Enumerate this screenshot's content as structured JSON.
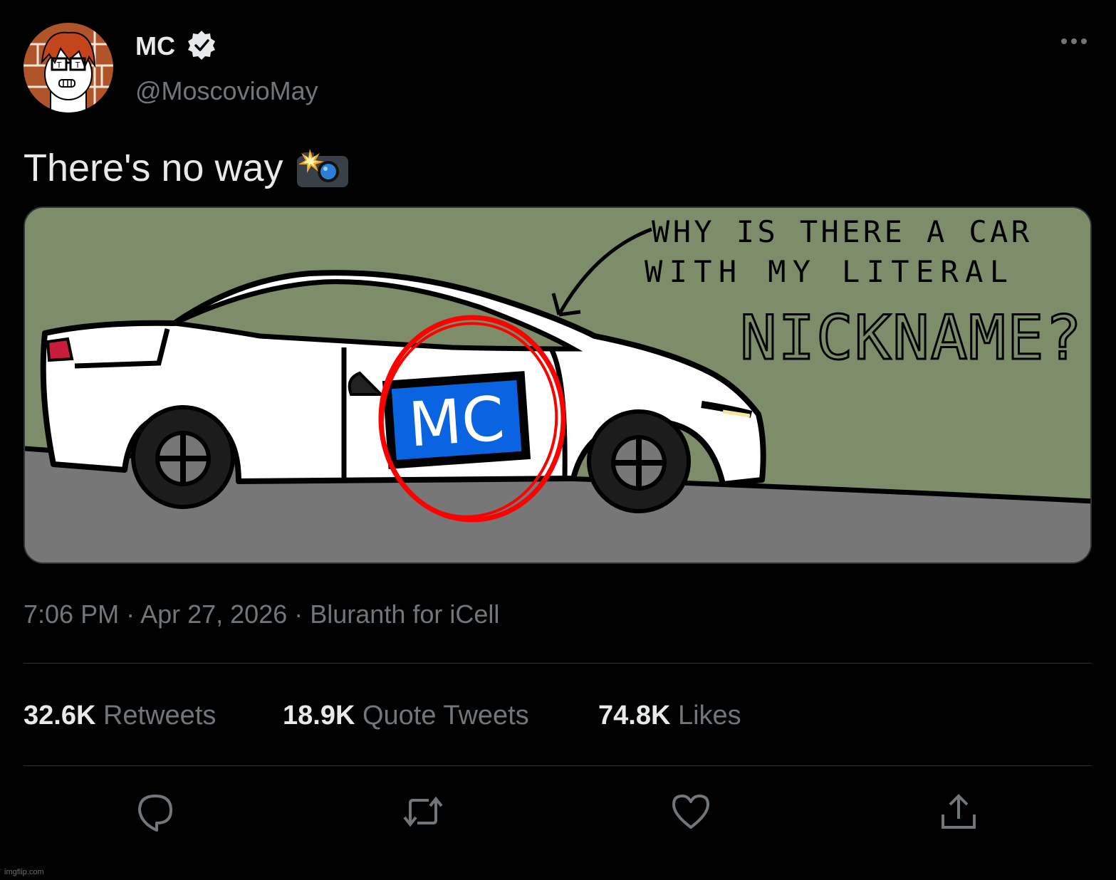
{
  "author": {
    "display_name": "MC",
    "handle": "@MoscovioMay",
    "verified_icon": "verified-badge-icon",
    "avatar_icon": "avatar"
  },
  "tweet": {
    "text": "There's no way",
    "emoji": "camera-with-flash"
  },
  "media": {
    "caption_line1": "WHY IS THERE A CAR",
    "caption_line2": "WITH MY LITERAL",
    "caption_line3": "NICKNAME?",
    "car_badge": "MC"
  },
  "meta": {
    "time": "7:06 PM",
    "sep1": " · ",
    "date": "Apr 27, 2026",
    "sep2": " · ",
    "source": "Bluranth for iCell"
  },
  "stats": {
    "retweets_count": "32.6K",
    "retweets_label": "Retweets",
    "quotes_count": "18.9K",
    "quotes_label": "Quote Tweets",
    "likes_count": "74.8K",
    "likes_label": "Likes"
  },
  "actions": [
    "reply-icon",
    "retweet-icon",
    "like-icon",
    "share-icon"
  ],
  "watermark": "imgflip.com",
  "colors": {
    "background": "#000000",
    "primary_text": "#e7e9ea",
    "secondary_text": "#71767b",
    "divider": "#2f3336",
    "media_wall": "#7d8d6a",
    "media_road": "#777777",
    "badge_blue": "#0a63e0",
    "circle_red": "#ff0000"
  }
}
